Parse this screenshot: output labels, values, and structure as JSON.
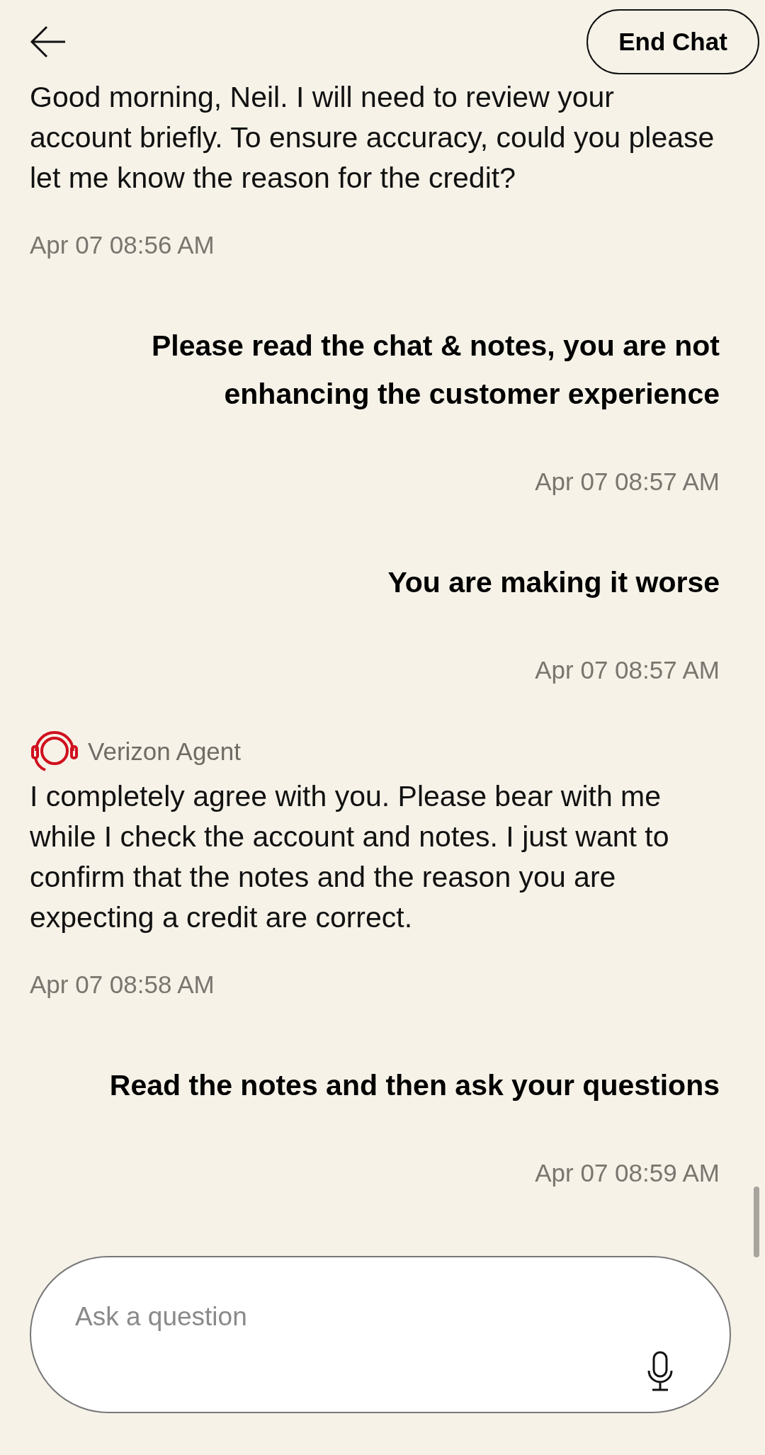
{
  "header": {
    "end_button": "End Chat"
  },
  "messages": [
    {
      "kind": "agent",
      "text": "Good morning, Neil. I will need to review your account briefly. To ensure accuracy, could you please let me know the reason for the credit?",
      "time": "Apr 07 08:56 AM"
    },
    {
      "kind": "user",
      "text": "Please read the chat & notes, you are not enhancing the customer experience",
      "time": "Apr 07 08:57 AM"
    },
    {
      "kind": "user",
      "text": "You are making it worse",
      "time": "Apr 07 08:57 AM"
    },
    {
      "kind": "agent",
      "sender": "Verizon Agent",
      "text": "I completely agree with you. Please bear with me while I check the account and notes. I just want to confirm that the notes and the reason you are expecting a credit are correct.",
      "time": "Apr 07 08:58 AM"
    },
    {
      "kind": "user",
      "text": "Read the notes and then ask your questions",
      "time": "Apr 07 08:59 AM"
    }
  ],
  "composer": {
    "placeholder": "Ask a question"
  }
}
